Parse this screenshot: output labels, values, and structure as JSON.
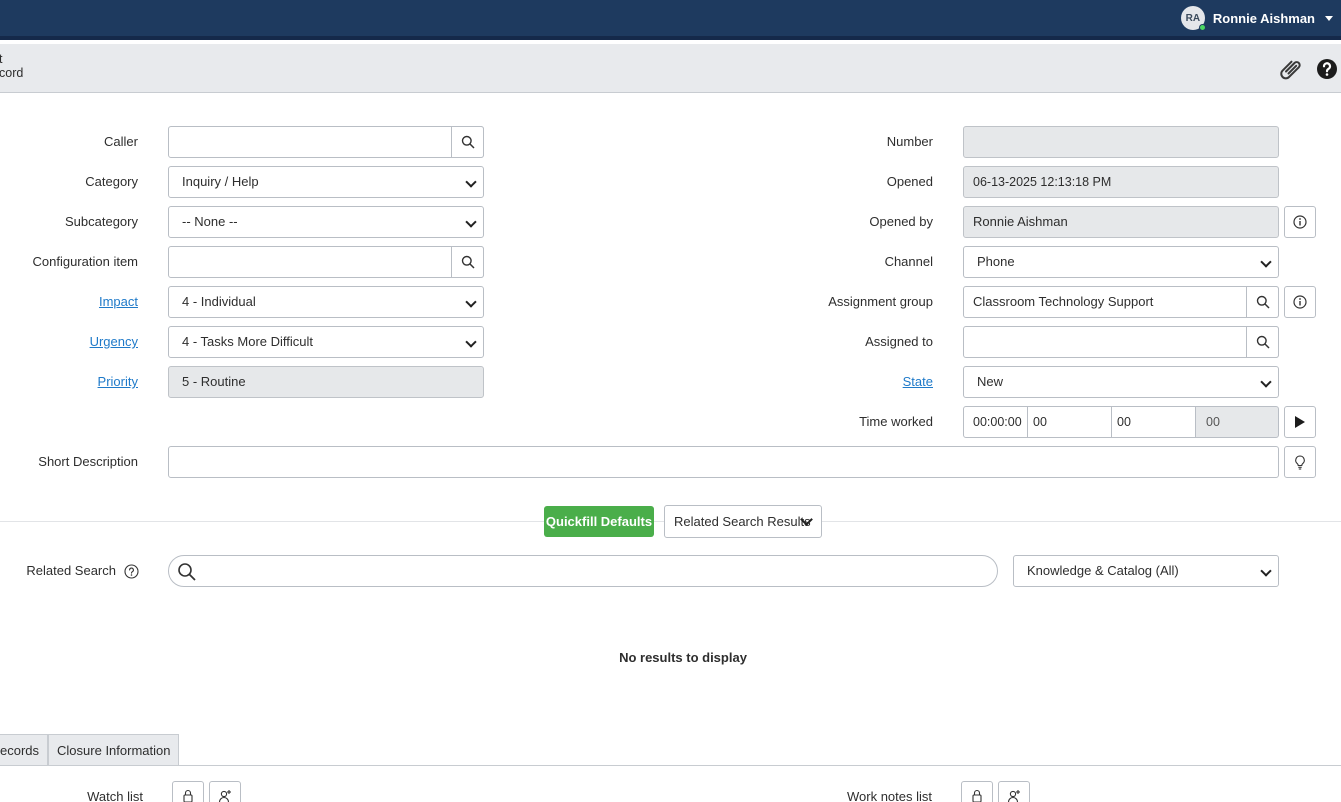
{
  "user": {
    "initials": "RA",
    "name": "Ronnie Aishman"
  },
  "header": {
    "title_line1": "t",
    "title_line2": "cord"
  },
  "form": {
    "caller": {
      "label": "Caller",
      "value": ""
    },
    "category": {
      "label": "Category",
      "value": "Inquiry / Help"
    },
    "subcategory": {
      "label": "Subcategory",
      "value": "-- None --"
    },
    "configuration_item": {
      "label": "Configuration item",
      "value": ""
    },
    "impact": {
      "label": "Impact",
      "value": "4 - Individual"
    },
    "urgency": {
      "label": "Urgency",
      "value": "4 - Tasks More Difficult"
    },
    "priority": {
      "label": "Priority",
      "value": "5 - Routine"
    },
    "number": {
      "label": "Number",
      "value": ""
    },
    "opened": {
      "label": "Opened",
      "value": "06-13-2025 12:13:18 PM"
    },
    "opened_by": {
      "label": "Opened by",
      "value": "Ronnie Aishman"
    },
    "channel": {
      "label": "Channel",
      "value": "Phone"
    },
    "assignment_group": {
      "label": "Assignment group",
      "value": "Classroom Technology Support"
    },
    "assigned_to": {
      "label": "Assigned to",
      "value": ""
    },
    "state": {
      "label": "State",
      "value": "New"
    },
    "time_worked": {
      "label": "Time worked",
      "total": "00:00:00",
      "hours": "00",
      "minutes": "00",
      "seconds": "00"
    },
    "short_description": {
      "label": "Short Description",
      "value": ""
    }
  },
  "actions": {
    "quickfill": "Quickfill Defaults",
    "related_results": "Related Search Results"
  },
  "related_search": {
    "label": "Related Search",
    "scope": "Knowledge & Catalog (All)",
    "empty": "No results to display"
  },
  "tabs": [
    "ecords",
    "Closure Information"
  ],
  "watch_list": {
    "label": "Watch list"
  },
  "work_notes_list": {
    "label": "Work notes list"
  },
  "colors": {
    "topbar": "#1e3a5f",
    "link": "#1f7ac9",
    "quickfill": "#4aae4a",
    "readonly": "#e6e8ea"
  }
}
